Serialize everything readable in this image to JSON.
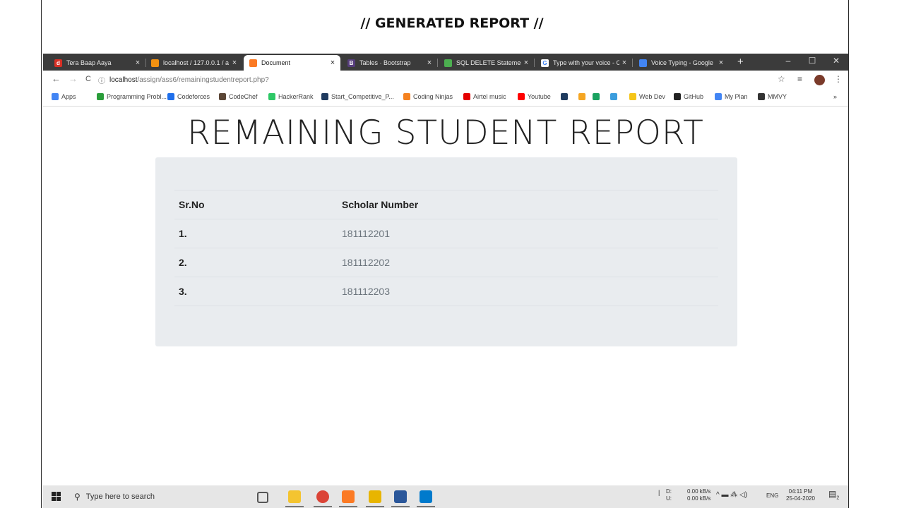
{
  "slide_title": "// GENERATED REPORT //",
  "browser": {
    "tabs": [
      {
        "label": "Tera Baap Aaya",
        "color": "#d93025",
        "letter": "d",
        "active": false
      },
      {
        "label": "localhost / 127.0.0.1 / a",
        "color": "#f29111",
        "letter": "",
        "active": false
      },
      {
        "label": "Document",
        "color": "#fb7a24",
        "letter": "",
        "active": true
      },
      {
        "label": "Tables · Bootstrap",
        "color": "#563d7c",
        "letter": "B",
        "active": false
      },
      {
        "label": "SQL DELETE Statement",
        "color": "#4caf50",
        "letter": "",
        "active": false
      },
      {
        "label": "Type with your voice - G",
        "color": "#ffffff",
        "letter": "G",
        "active": false
      },
      {
        "label": "Voice Typing - Google",
        "color": "#4285f4",
        "letter": "",
        "active": false
      }
    ],
    "tab_close": "×",
    "new_tab": "+",
    "window_controls": {
      "minimize": "–",
      "maximize": "☐",
      "close": "✕"
    },
    "nav": {
      "back": "←",
      "forward": "→",
      "reload": "C",
      "info": "ⓘ"
    },
    "url_host": "localhost",
    "url_path": "/assign/ass6/remainingstudentreport.php?",
    "toolbar_icons": {
      "star": "☆",
      "reading_list": "≡",
      "menu": "⋮"
    },
    "bookmarks": [
      {
        "label": "Apps",
        "color": "#4285f4"
      },
      {
        "label": "Programming Probl...",
        "color": "#2a9d3a"
      },
      {
        "label": "Codeforces",
        "color": "#1f6feb"
      },
      {
        "label": "CodeChef",
        "color": "#5b4636"
      },
      {
        "label": "HackerRank",
        "color": "#2ec866"
      },
      {
        "label": "Start_Competitive_P...",
        "color": "#1f3b5f"
      },
      {
        "label": "Coding Ninjas",
        "color": "#f58220"
      },
      {
        "label": "Airtel music",
        "color": "#e40000"
      },
      {
        "label": "Youtube",
        "color": "#ff0000"
      },
      {
        "label": "",
        "color": "#1f3b5f"
      },
      {
        "label": "",
        "color": "#f5a623"
      },
      {
        "label": "",
        "color": "#1aa260"
      },
      {
        "label": "",
        "color": "#3b9ddd"
      },
      {
        "label": "Web Dev",
        "color": "#f5c518"
      },
      {
        "label": "GitHub",
        "color": "#222222"
      },
      {
        "label": "My Plan",
        "color": "#4285f4"
      },
      {
        "label": "MMVY",
        "color": "#333333"
      }
    ],
    "bookmarks_more": "»"
  },
  "report": {
    "title": "REMAINING STUDENT REPORT",
    "headers": [
      "Sr.No",
      "Scholar Number"
    ],
    "rows": [
      {
        "sr": "1.",
        "scholar": "181112201"
      },
      {
        "sr": "2.",
        "scholar": "181112202"
      },
      {
        "sr": "3.",
        "scholar": "181112203"
      }
    ]
  },
  "taskbar": {
    "search_placeholder": "Type here to search",
    "apps": [
      {
        "name": "task-view",
        "color": "#555555"
      },
      {
        "name": "file-explorer",
        "color": "#f4c430"
      },
      {
        "name": "chrome",
        "color": "#db4437"
      },
      {
        "name": "xampp",
        "color": "#fb7a24"
      },
      {
        "name": "app-yellow",
        "color": "#e8b500"
      },
      {
        "name": "word",
        "color": "#2b579a"
      },
      {
        "name": "vscode",
        "color": "#007acc"
      }
    ],
    "net_drive_d": "D:",
    "net_drive_u": "U:",
    "net_speed_down": "0.00 kB/s",
    "net_speed_up": "0.00 kB/s",
    "tray_icons": "^ ▬ ⁂ ◁)",
    "language": "ENG",
    "time": "04:11 PM",
    "date": "25-04-2020",
    "notifications": "2"
  }
}
